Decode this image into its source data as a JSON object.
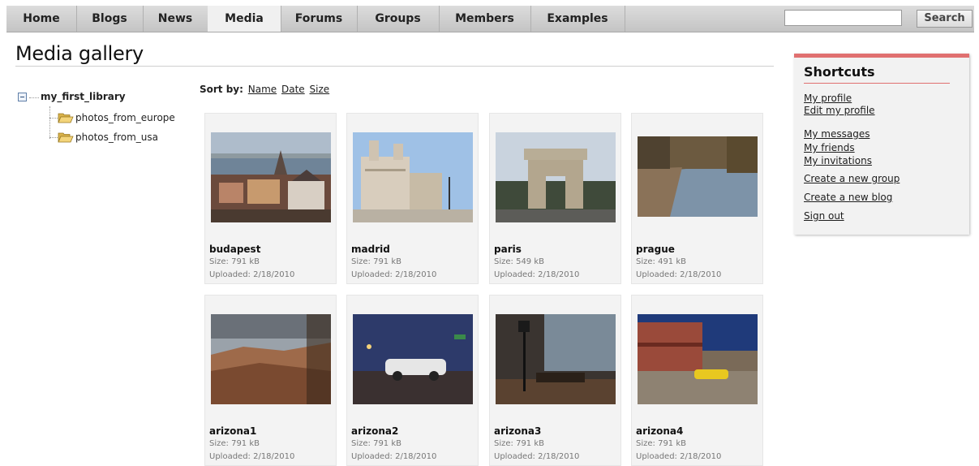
{
  "nav": {
    "tabs": [
      "Home",
      "Blogs",
      "News",
      "Media",
      "Forums",
      "Groups",
      "Members",
      "Examples"
    ],
    "active": "Media",
    "search_placeholder": "",
    "search_button": "Search"
  },
  "page": {
    "title": "Media gallery"
  },
  "tree": {
    "root": "my_first_library",
    "children": [
      "photos_from_europe",
      "photos_from_usa"
    ]
  },
  "sort": {
    "label": "Sort by:",
    "options": [
      "Name",
      "Date",
      "Size"
    ]
  },
  "gallery": [
    {
      "name": "budapest",
      "size": "Size: 791 kB",
      "uploaded": "Uploaded: 2/18/2010"
    },
    {
      "name": "madrid",
      "size": "Size: 791 kB",
      "uploaded": "Uploaded: 2/18/2010"
    },
    {
      "name": "paris",
      "size": "Size: 549 kB",
      "uploaded": "Uploaded: 2/18/2010"
    },
    {
      "name": "prague",
      "size": "Size: 491 kB",
      "uploaded": "Uploaded: 2/18/2010"
    },
    {
      "name": "arizona1",
      "size": "Size: 791 kB",
      "uploaded": "Uploaded: 2/18/2010"
    },
    {
      "name": "arizona2",
      "size": "Size: 791 kB",
      "uploaded": "Uploaded: 2/18/2010"
    },
    {
      "name": "arizona3",
      "size": "Size: 791 kB",
      "uploaded": "Uploaded: 2/18/2010"
    },
    {
      "name": "arizona4",
      "size": "Size: 791 kB",
      "uploaded": "Uploaded: 2/18/2010"
    }
  ],
  "shortcuts": {
    "title": "Shortcuts",
    "links": [
      "My profile",
      "Edit my profile",
      "My messages",
      "My friends",
      "My invitations",
      "Create a new group",
      "Create a new blog",
      "Sign out"
    ]
  },
  "colors": {
    "accent": "#e07070",
    "nav_bg": "#cfcfcf",
    "card_bg": "#f3f3f3"
  }
}
